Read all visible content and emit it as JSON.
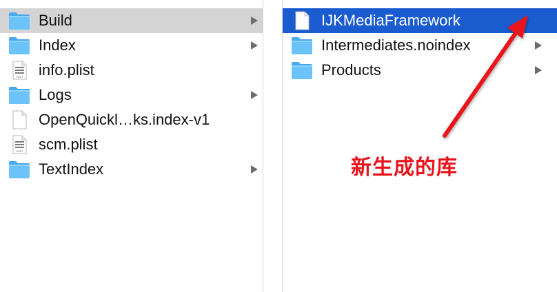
{
  "columns": [
    {
      "items": [
        {
          "label": "Build",
          "icon": "folder-icon",
          "has_children": true,
          "selected": "gray"
        },
        {
          "label": "Index",
          "icon": "folder-icon",
          "has_children": true,
          "selected": ""
        },
        {
          "label": "info.plist",
          "icon": "plist-file-icon",
          "has_children": false,
          "selected": ""
        },
        {
          "label": "Logs",
          "icon": "folder-icon",
          "has_children": true,
          "selected": ""
        },
        {
          "label": "OpenQuickl…ks.index-v1",
          "icon": "document-icon",
          "has_children": false,
          "selected": ""
        },
        {
          "label": "scm.plist",
          "icon": "plist-file-icon",
          "has_children": false,
          "selected": ""
        },
        {
          "label": "TextIndex",
          "icon": "folder-icon",
          "has_children": true,
          "selected": ""
        }
      ]
    },
    {
      "items": [
        {
          "label": "IJKMediaFramework",
          "icon": "document-icon",
          "has_children": false,
          "selected": "blue"
        },
        {
          "label": "Intermediates.noindex",
          "icon": "folder-icon",
          "has_children": true,
          "selected": ""
        },
        {
          "label": "Products",
          "icon": "folder-icon",
          "has_children": true,
          "selected": ""
        }
      ]
    }
  ],
  "annotation": {
    "text": "新生成的库",
    "color": "#e8141c"
  },
  "colors": {
    "selection_blue": "#1a5ccf",
    "selection_gray": "#d4d4d4",
    "folder_blue": "#5cb8f5"
  }
}
